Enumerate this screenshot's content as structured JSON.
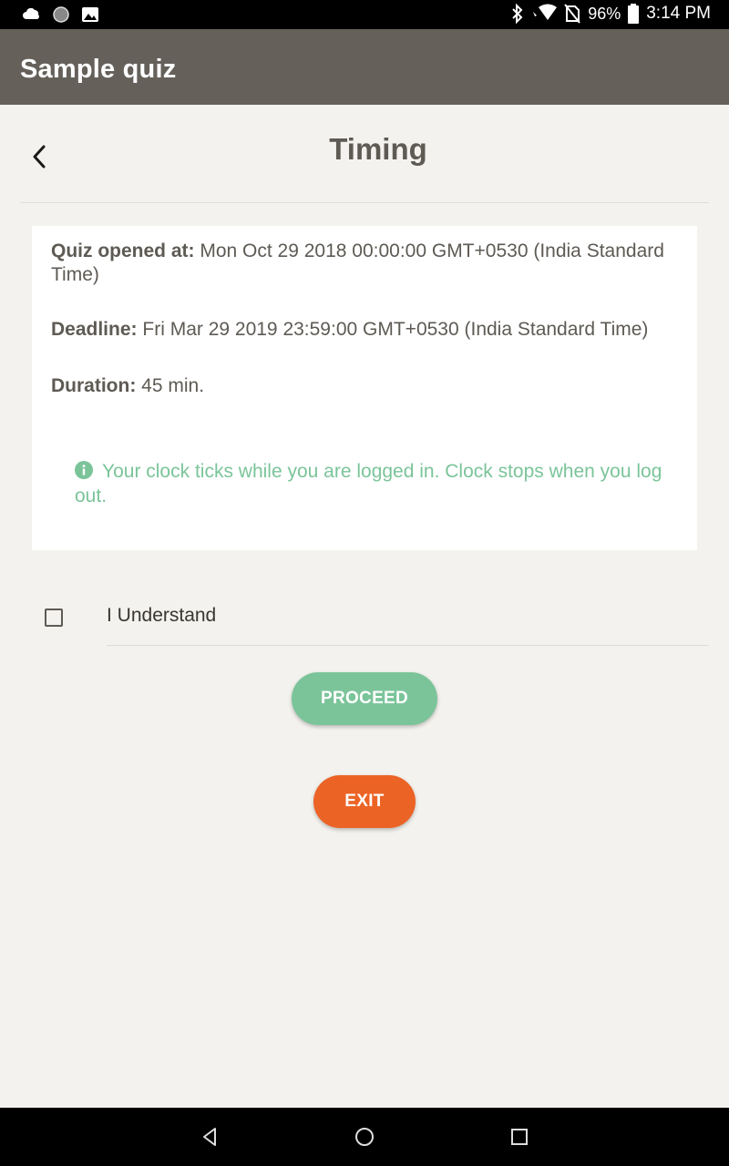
{
  "status_bar": {
    "battery": "96%",
    "time": "3:14 PM",
    "icons_left": [
      "cloud-icon",
      "circle-icon",
      "image-icon"
    ],
    "icons_right": [
      "bluetooth-icon",
      "wifi-icon",
      "no-sim-icon",
      "battery-icon"
    ]
  },
  "app_bar": {
    "title": "Sample quiz"
  },
  "header": {
    "title": "Timing",
    "back_icon": "chevron-left-icon"
  },
  "info": {
    "opened_label": "Quiz opened at:",
    "opened_value": "Mon Oct 29 2018 00:00:00 GMT+0530 (India Standard Time)",
    "deadline_label": "Deadline:",
    "deadline_value": "Fri Mar 29 2019 23:59:00 GMT+0530 (India Standard Time)",
    "duration_label": "Duration:",
    "duration_value": "45 min.",
    "note": "Your clock ticks while you are logged in. Clock stops when you log out.",
    "note_icon": "info-icon"
  },
  "agreement": {
    "label": "I Understand",
    "checked": false
  },
  "buttons": {
    "proceed": "PROCEED",
    "exit": "EXIT"
  },
  "colors": {
    "app_bar": "#65605a",
    "accent_green": "#7bc49a",
    "exit_orange": "#ec6326",
    "background": "#f3f2ee"
  }
}
